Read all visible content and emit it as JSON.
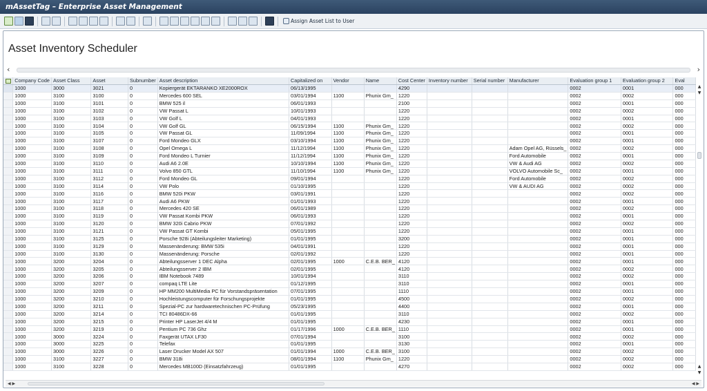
{
  "window": {
    "title": "mAssetTag – Enterprise Asset Management"
  },
  "toolbar": {
    "assign_label": "Assign Asset List to User",
    "icons": [
      "check-icon",
      "save-icon",
      "back-icon",
      "details-icon",
      "select-all-icon",
      "print-icon",
      "filter-icon",
      "filter-off-icon",
      "sort-ascending-icon",
      "sort-descending-icon",
      "sum-icon",
      "subtotal-icon",
      "refresh-icon",
      "export-icon",
      "spreadsheet-icon",
      "local-file-icon",
      "word-processing-icon",
      "layout-icon",
      "change-layout-icon",
      "save-layout-icon",
      "info-icon",
      "assign-user-icon"
    ]
  },
  "page": {
    "title": "Asset Inventory Scheduler"
  },
  "table": {
    "columns": [
      "Company Code",
      "Asset Class",
      "Asset",
      "Subnumber",
      "Asset description",
      "Capitalized on",
      "Vendor",
      "Name",
      "Cost Center",
      "Inventory number",
      "Serial number",
      "Manufacturer",
      "Evaluation group 1",
      "Evaluation group 2",
      "Eval"
    ],
    "rows": [
      [
        "1000",
        "3000",
        "3021",
        "0",
        "Kopiergerät EKTARANKO XE2000ROX",
        "06/13/1995",
        "",
        "",
        "4290",
        "",
        "",
        "",
        "0002",
        "0001",
        "000"
      ],
      [
        "1000",
        "3100",
        "3100",
        "0",
        "Mercedes 600 SEL",
        "03/01/1994",
        "1100",
        "Phunix Gm_",
        "1220",
        "",
        "",
        "",
        "0002",
        "0002",
        "000"
      ],
      [
        "1000",
        "3100",
        "3101",
        "0",
        "BMW 525 il",
        "06/01/1993",
        "",
        "",
        "2100",
        "",
        "",
        "",
        "0002",
        "0001",
        "000"
      ],
      [
        "1000",
        "3100",
        "3102",
        "0",
        "VW Passat L",
        "10/01/1993",
        "",
        "",
        "1220",
        "",
        "",
        "",
        "0002",
        "0002",
        "000"
      ],
      [
        "1000",
        "3100",
        "3103",
        "0",
        "VW Golf L",
        "04/01/1993",
        "",
        "",
        "1220",
        "",
        "",
        "",
        "0002",
        "0001",
        "000"
      ],
      [
        "1000",
        "3100",
        "3104",
        "0",
        "VW Golf GL",
        "06/15/1994",
        "1100",
        "Phunix Gm_",
        "1220",
        "",
        "",
        "",
        "0002",
        "0002",
        "000"
      ],
      [
        "1000",
        "3100",
        "3105",
        "0",
        "VW Passat GL",
        "11/09/1994",
        "1100",
        "Phunix Gm_",
        "1220",
        "",
        "",
        "",
        "0002",
        "0001",
        "000"
      ],
      [
        "1000",
        "3100",
        "3107",
        "0",
        "Ford Mondeo GLX",
        "03/10/1994",
        "1100",
        "Phunix Gm_",
        "1220",
        "",
        "",
        "",
        "0002",
        "0001",
        "000"
      ],
      [
        "1000",
        "3100",
        "3108",
        "0",
        "Opel Omega L",
        "11/12/1994",
        "1100",
        "Phunix Gm_",
        "1220",
        "",
        "",
        "Adam Opel AG, Rüssels_",
        "0002",
        "0002",
        "000"
      ],
      [
        "1000",
        "3100",
        "3109",
        "0",
        "Ford Mondeo L Turnier",
        "11/12/1994",
        "1100",
        "Phunix Gm_",
        "1220",
        "",
        "",
        "Ford Automobile",
        "0002",
        "0001",
        "000"
      ],
      [
        "1000",
        "3100",
        "3110",
        "0",
        "Audi A6 2.0E",
        "10/10/1994",
        "1100",
        "Phunix Gm_",
        "1220",
        "",
        "",
        "VW & Audi AG",
        "0002",
        "0002",
        "000"
      ],
      [
        "1000",
        "3100",
        "3111",
        "0",
        "Volvo 850 GTL",
        "11/10/1994",
        "1100",
        "Phunix Gm_",
        "1220",
        "",
        "",
        "VOLVO Automobile Sc_",
        "0002",
        "0001",
        "000"
      ],
      [
        "1000",
        "3100",
        "3112",
        "0",
        "Ford Mondeo GL",
        "09/01/1994",
        "",
        "",
        "1220",
        "",
        "",
        "Ford Automobile",
        "0002",
        "0002",
        "000"
      ],
      [
        "1000",
        "3100",
        "3114",
        "0",
        "VW Polo",
        "01/10/1995",
        "",
        "",
        "1220",
        "",
        "",
        "VW & AUDI AG",
        "0002",
        "0002",
        "000"
      ],
      [
        "1000",
        "3100",
        "3116",
        "0",
        "BMW 520i PKW",
        "03/01/1991",
        "",
        "",
        "1220",
        "",
        "",
        "",
        "0002",
        "0002",
        "000"
      ],
      [
        "1000",
        "3100",
        "3117",
        "0",
        "Audi A6 PKW",
        "01/01/1993",
        "",
        "",
        "1220",
        "",
        "",
        "",
        "0002",
        "0001",
        "000"
      ],
      [
        "1000",
        "3100",
        "3118",
        "0",
        "Mercedes 420 SE",
        "06/01/1989",
        "",
        "",
        "1220",
        "",
        "",
        "",
        "0002",
        "0002",
        "000"
      ],
      [
        "1000",
        "3100",
        "3119",
        "0",
        "VW Passat Kombi PKW",
        "06/01/1993",
        "",
        "",
        "1220",
        "",
        "",
        "",
        "0002",
        "0001",
        "000"
      ],
      [
        "1000",
        "3100",
        "3120",
        "0",
        "BMW 320i Cabrio PKW",
        "07/01/1992",
        "",
        "",
        "1220",
        "",
        "",
        "",
        "0002",
        "0002",
        "000"
      ],
      [
        "1000",
        "3100",
        "3121",
        "0",
        "VW Passat GT Kombi",
        "05/01/1995",
        "",
        "",
        "1220",
        "",
        "",
        "",
        "0002",
        "0001",
        "000"
      ],
      [
        "1000",
        "3100",
        "3125",
        "0",
        "Porsche 928i (Abteilungsleiter Marketing)",
        "01/01/1995",
        "",
        "",
        "3200",
        "",
        "",
        "",
        "0002",
        "0001",
        "000"
      ],
      [
        "1000",
        "3100",
        "3129",
        "0",
        "Massenänderung: BMW 535i",
        "04/01/1991",
        "",
        "",
        "1220",
        "",
        "",
        "",
        "0002",
        "0001",
        "000"
      ],
      [
        "1000",
        "3100",
        "3130",
        "0",
        "Massenänderung: Porsche",
        "02/01/1992",
        "",
        "",
        "1220",
        "",
        "",
        "",
        "0002",
        "0001",
        "000"
      ],
      [
        "1000",
        "3200",
        "3204",
        "0",
        "Abteilungsserver 1 DEC Alpha",
        "02/01/1995",
        "1000",
        "C.E.B. BER_",
        "4120",
        "",
        "",
        "",
        "0002",
        "0001",
        "000"
      ],
      [
        "1000",
        "3200",
        "3205",
        "0",
        "Abteilungsserver 2 IBM",
        "02/01/1995",
        "",
        "",
        "4120",
        "",
        "",
        "",
        "0002",
        "0002",
        "000"
      ],
      [
        "1000",
        "3200",
        "3206",
        "0",
        "IBM Notebook 7489",
        "10/01/1994",
        "",
        "",
        "3110",
        "",
        "",
        "",
        "0002",
        "0002",
        "000"
      ],
      [
        "1000",
        "3200",
        "3207",
        "0",
        "compaq LTE Lite",
        "01/12/1995",
        "",
        "",
        "3110",
        "",
        "",
        "",
        "0002",
        "0001",
        "000"
      ],
      [
        "1000",
        "3200",
        "3209",
        "0",
        "HP MM200 MultiMedia PC für Vorstandspräsentation",
        "07/01/1995",
        "",
        "",
        "1110",
        "",
        "",
        "",
        "0002",
        "0001",
        "000"
      ],
      [
        "1000",
        "3200",
        "3210",
        "0",
        "Hochleistungscomputer für Forschungsprojekte",
        "01/01/1995",
        "",
        "",
        "4500",
        "",
        "",
        "",
        "0002",
        "0002",
        "000"
      ],
      [
        "1000",
        "3200",
        "3211",
        "0",
        "Spezial-PC zur hardwaretechnischen PC-Prüfung",
        "05/23/1995",
        "",
        "",
        "4400",
        "",
        "",
        "",
        "0002",
        "0001",
        "000"
      ],
      [
        "1000",
        "3200",
        "3214",
        "0",
        "TCI 80486DX-66",
        "01/01/1995",
        "",
        "",
        "3110",
        "",
        "",
        "",
        "0002",
        "0002",
        "000"
      ],
      [
        "1000",
        "3200",
        "3215",
        "0",
        "Printer HP LaserJet 4/4 M",
        "01/01/1995",
        "",
        "",
        "4230",
        "",
        "",
        "",
        "0002",
        "0001",
        "000"
      ],
      [
        "1000",
        "3200",
        "3219",
        "0",
        "Pentium PC 736 Ghz",
        "01/17/1996",
        "1000",
        "C.E.B. BER_",
        "1110",
        "",
        "",
        "",
        "0002",
        "0001",
        "000"
      ],
      [
        "1000",
        "3000",
        "3224",
        "0",
        "Faxgerät UTAX LF30",
        "07/01/1994",
        "",
        "",
        "3100",
        "",
        "",
        "",
        "0002",
        "0002",
        "000"
      ],
      [
        "1000",
        "3000",
        "3225",
        "0",
        "Telefax",
        "01/01/1995",
        "",
        "",
        "3130",
        "",
        "",
        "",
        "0002",
        "0001",
        "000"
      ],
      [
        "1000",
        "3000",
        "3226",
        "0",
        "Laser Drucker Model AX 507",
        "01/01/1994",
        "1000",
        "C.E.B. BER_",
        "3100",
        "",
        "",
        "",
        "0002",
        "0002",
        "000"
      ],
      [
        "1000",
        "3100",
        "3227",
        "0",
        "BMW 318i",
        "08/01/1994",
        "1100",
        "Phunix Gm_",
        "1220",
        "",
        "",
        "",
        "0002",
        "0002",
        "000"
      ],
      [
        "1000",
        "3100",
        "3228",
        "0",
        "Mercedes MB100D (Einsatzfahrzeug)",
        "01/01/1995",
        "",
        "",
        "4270",
        "",
        "",
        "",
        "0002",
        "0002",
        "000"
      ]
    ]
  }
}
